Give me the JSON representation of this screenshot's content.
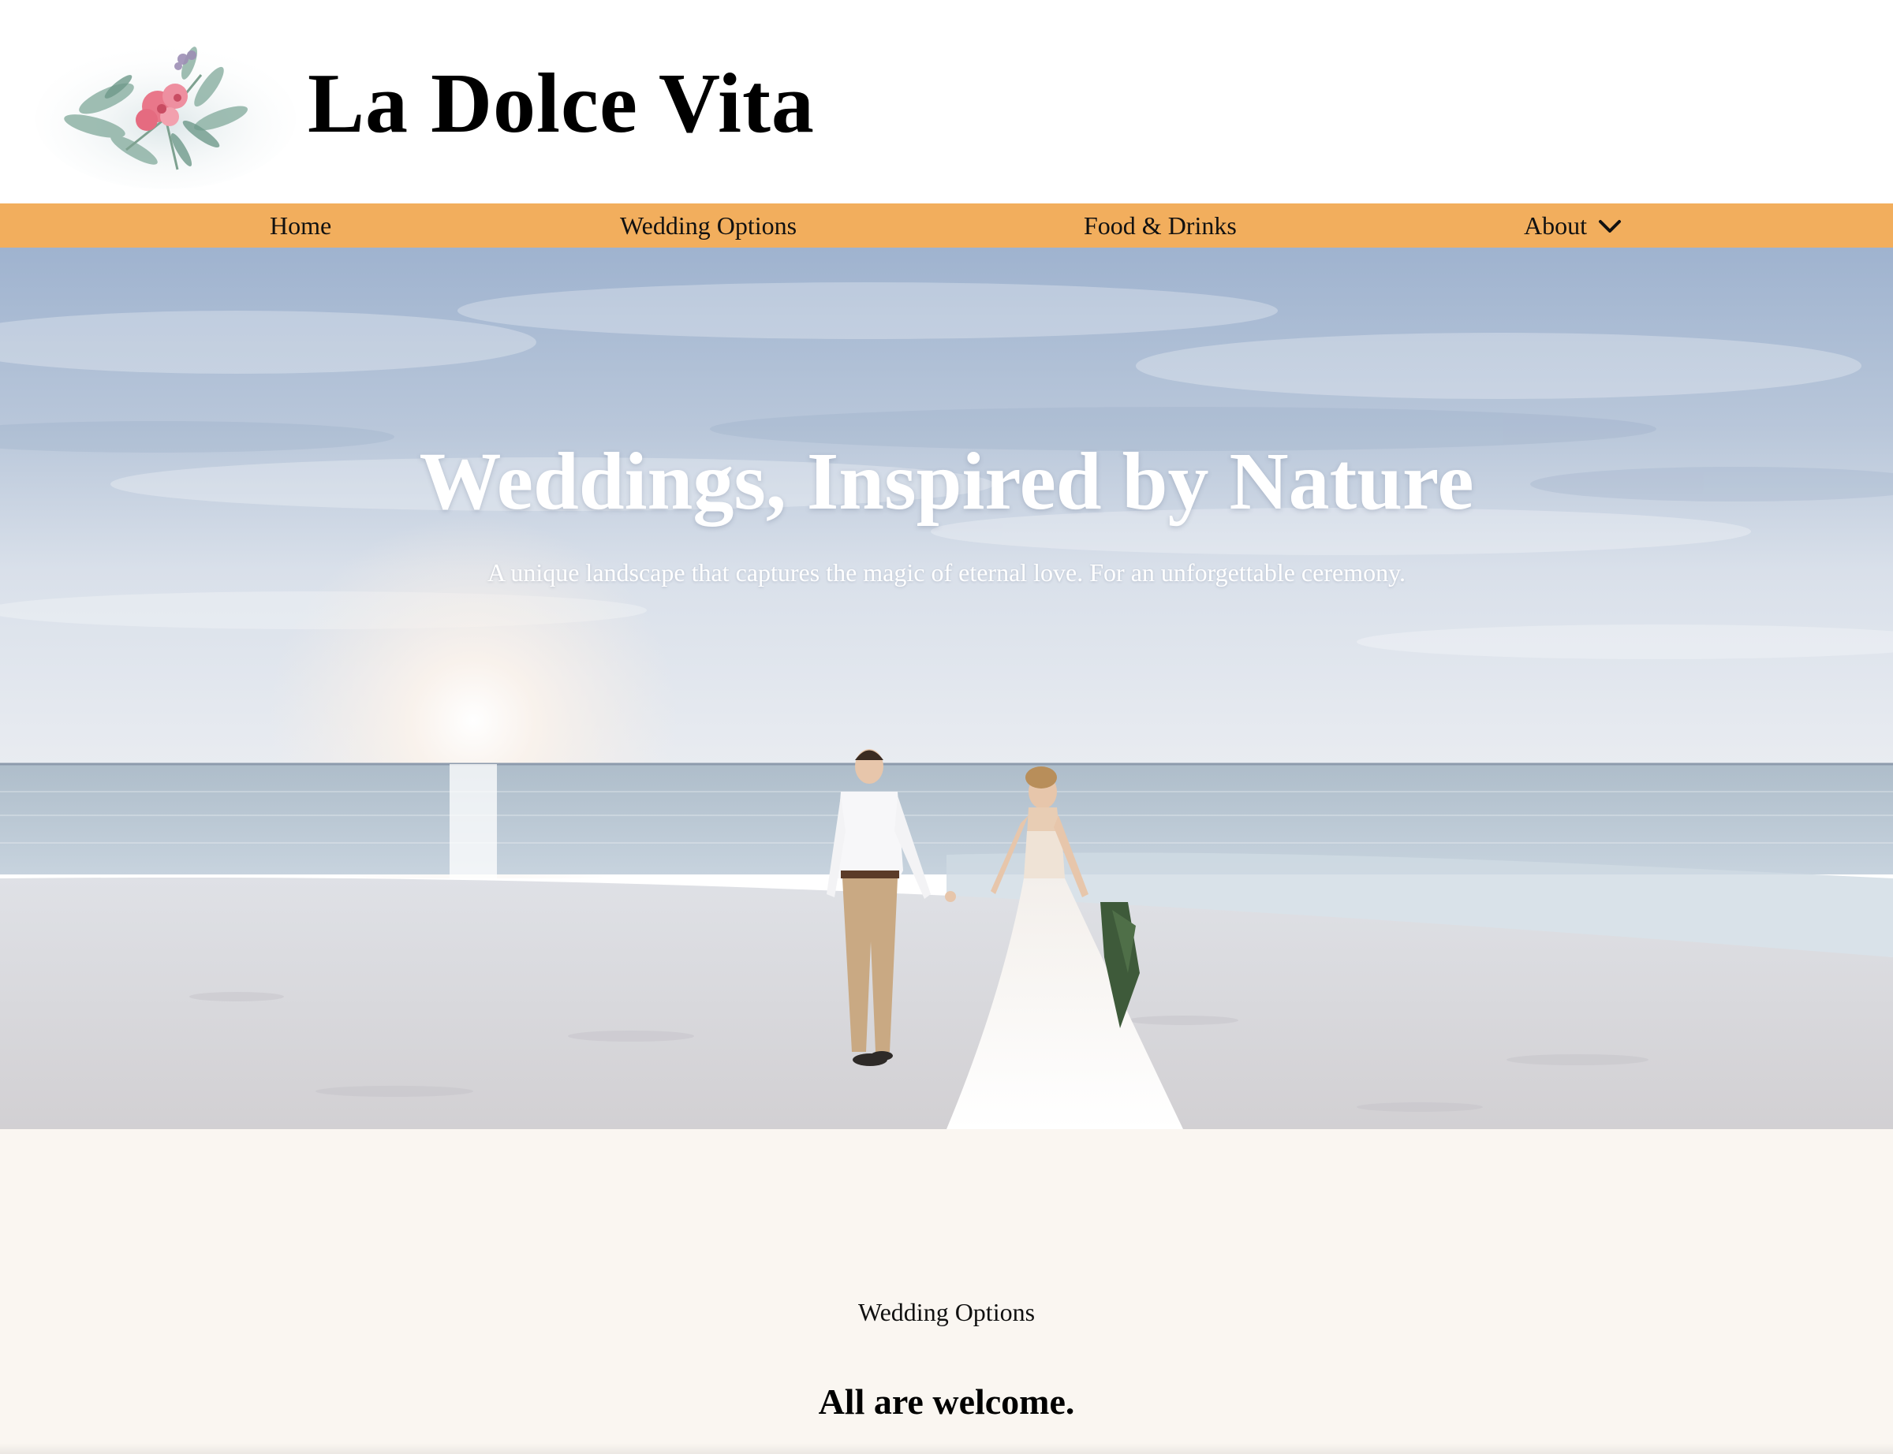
{
  "header": {
    "site_title": "La Dolce Vita",
    "logo_icon": "floral-watercolor-logo"
  },
  "nav": {
    "items": [
      {
        "label": "Home"
      },
      {
        "label": "Wedding Options"
      },
      {
        "label": "Food & Drinks"
      },
      {
        "label": "About",
        "icon": "chevron-down-icon"
      }
    ],
    "background_color": "#f2ae5d"
  },
  "hero": {
    "title": "Weddings, Inspired by Nature",
    "subtitle": "A unique landscape that captures the magic of eternal love. For an unforgettable ceremony.",
    "image": "beach-wedding-couple-sunset"
  },
  "section": {
    "kicker": "Wedding Options",
    "heading": "All are welcome.",
    "background_color": "#faf6f1"
  }
}
